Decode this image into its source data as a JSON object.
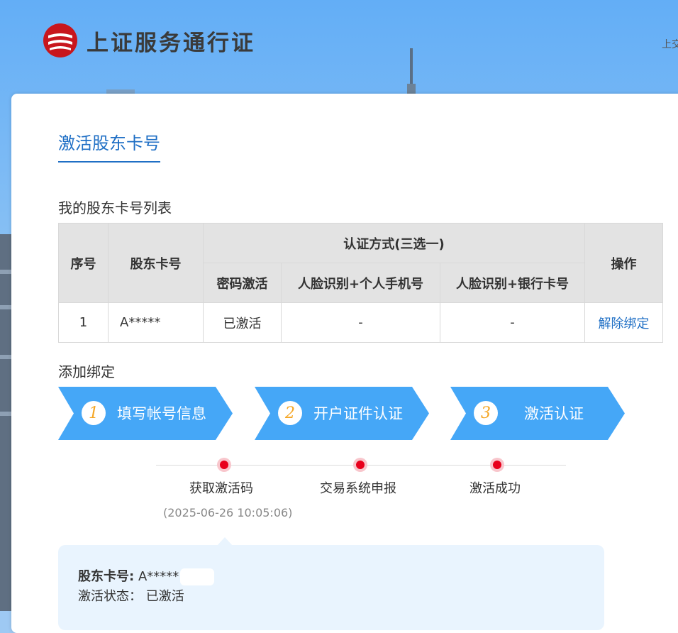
{
  "header": {
    "logo_text": "上证服务通行证",
    "top_right_text": "上交"
  },
  "page": {
    "title": "激活股东卡号",
    "list_label": "我的股东卡号列表",
    "add_label": "添加绑定"
  },
  "table": {
    "headers": {
      "seq": "序号",
      "account": "股东卡号",
      "auth_group": "认证方式(三选一)",
      "auth_password": "密码激活",
      "auth_face_phone": "人脸识别+个人手机号",
      "auth_face_bank": "人脸识别+银行卡号",
      "action": "操作"
    },
    "rows": [
      {
        "seq": "1",
        "account": "A*****",
        "password_status": "已激活",
        "face_phone_status": "-",
        "face_bank_status": "-",
        "action": "解除绑定"
      }
    ]
  },
  "steps": [
    {
      "num": "1",
      "label": "填写帐号信息"
    },
    {
      "num": "2",
      "label": "开户证件认证"
    },
    {
      "num": "3",
      "label": "激活认证"
    }
  ],
  "timeline": {
    "items": [
      {
        "label": "获取激活码"
      },
      {
        "label": "交易系统申报"
      },
      {
        "label": "激活成功"
      }
    ],
    "time": "(2025-06-26 10:05:06)"
  },
  "info": {
    "account_key": "股东卡号:",
    "account_value": "A*****",
    "status_key": "激活状态：",
    "status_value": "已激活"
  },
  "colors": {
    "accent": "#1f6fc5",
    "step_blue": "#45a7f7",
    "timeline_dot": "#e8001c",
    "step_number": "#f5a623"
  }
}
